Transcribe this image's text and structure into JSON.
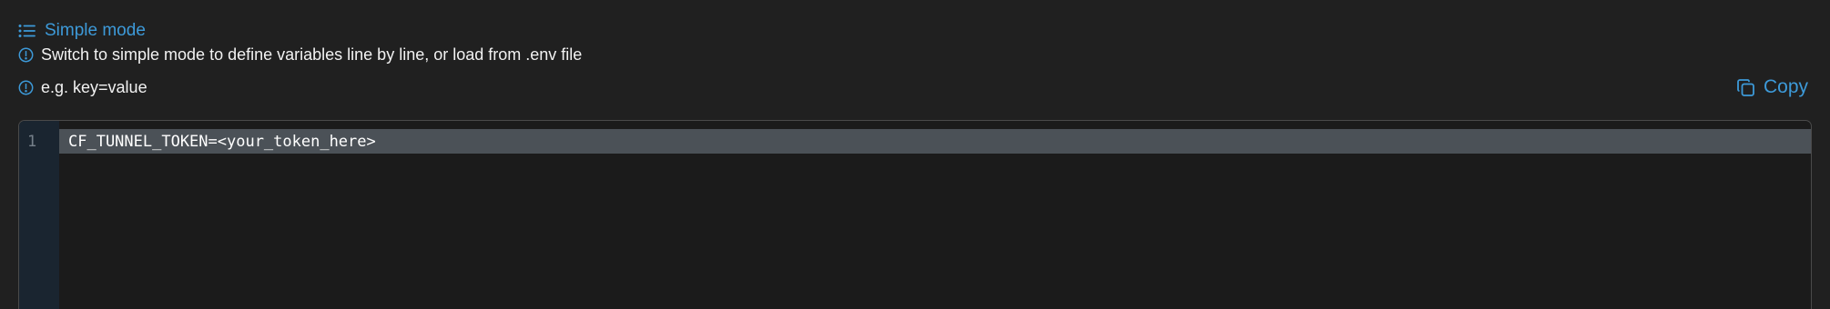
{
  "mode_toggle": {
    "label": "Simple mode",
    "icon": "list-icon"
  },
  "hints": [
    {
      "icon": "info-circle-icon",
      "text": "Switch to simple mode to define variables line by line, or load from .env file"
    },
    {
      "icon": "info-circle-icon",
      "text": "e.g. key=value"
    }
  ],
  "copy": {
    "label": "Copy",
    "icon": "copy-icon"
  },
  "editor": {
    "lines": [
      {
        "number": "1",
        "content": "CF_TUNNEL_TOKEN=<your_token_here>"
      }
    ]
  },
  "colors": {
    "background": "#202020",
    "accent": "#3d9ad9",
    "editor_background": "#1b1b1b",
    "gutter_background": "#1a2530",
    "active_line": "#4b5157"
  }
}
